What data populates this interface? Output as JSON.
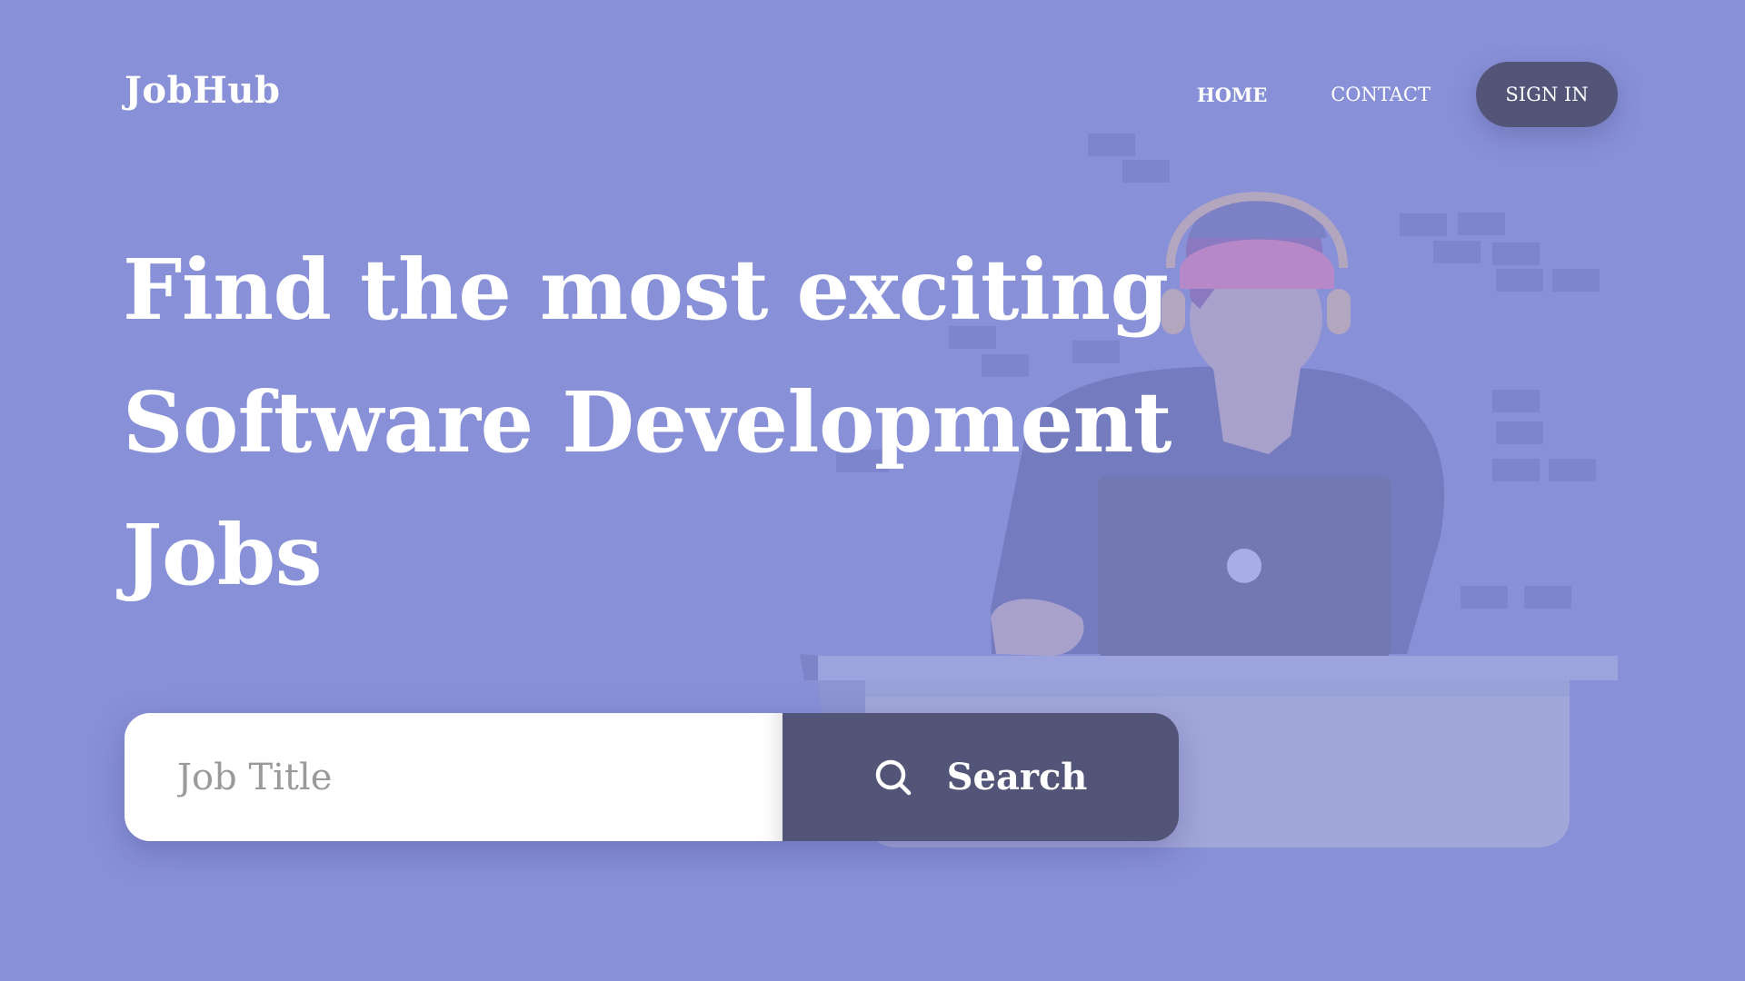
{
  "brand": {
    "logo_text": "JobHub"
  },
  "nav": {
    "home_label": "HOME",
    "contact_label": "CONTACT",
    "signin_label": "SIGN IN"
  },
  "hero": {
    "headline_lines": [
      "Find the most exciting",
      "Software Development",
      "Jobs"
    ]
  },
  "search": {
    "placeholder": "Job Title",
    "value": "",
    "button_label": "Search",
    "icon": "search-icon"
  },
  "colors": {
    "background": "#8890d8",
    "button_dark": "#535578",
    "text_light": "#ffffff",
    "input_bg": "#ffffff",
    "placeholder": "#9a9a9a"
  }
}
